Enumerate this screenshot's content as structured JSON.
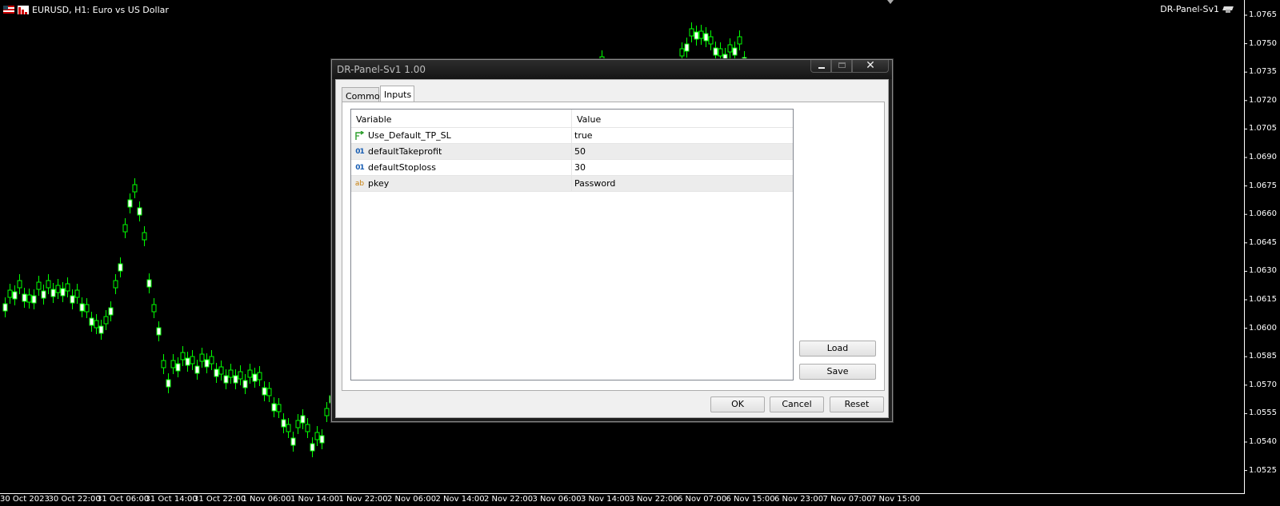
{
  "chart": {
    "symbol_title": "EURUSD, H1:  Euro vs US Dollar",
    "ea_name": "DR-Panel-Sv1",
    "colors": {
      "background": "#000000",
      "candle": "#00ff00",
      "text": "#ffffff"
    },
    "price_labels": [
      "1.0765",
      "1.0750",
      "1.0735",
      "1.0720",
      "1.0705",
      "1.0690",
      "1.0675",
      "1.0660",
      "1.0645",
      "1.0630",
      "1.0615",
      "1.0600",
      "1.0585",
      "1.0570",
      "1.0555",
      "1.0540",
      "1.0525"
    ],
    "time_labels": [
      "30 Oct 2023",
      "30 Oct 22:00",
      "31 Oct 06:00",
      "31 Oct 14:00",
      "31 Oct 22:00",
      "1 Nov 06:00",
      "1 Nov 14:00",
      "1 Nov 22:00",
      "2 Nov 06:00",
      "2 Nov 14:00",
      "2 Nov 22:00",
      "3 Nov 06:00",
      "3 Nov 14:00",
      "3 Nov 22:00",
      "6 Nov 07:00",
      "6 Nov 15:00",
      "6 Nov 23:00",
      "7 Nov 07:00",
      "7 Nov 15:00"
    ]
  },
  "dialog": {
    "title": "DR-Panel-Sv1 1.00",
    "tabs": [
      "Common",
      "Inputs"
    ],
    "active_tab": "Inputs",
    "columns": [
      "Variable",
      "Value"
    ],
    "rows": [
      {
        "icon": "bool-arrow-icon",
        "variable": "Use_Default_TP_SL",
        "value": "true"
      },
      {
        "icon": "numeric-icon",
        "icon_text": "01",
        "variable": "defaultTakeprofit",
        "value": "50"
      },
      {
        "icon": "numeric-icon",
        "icon_text": "01",
        "variable": "defaultStoploss",
        "value": "30"
      },
      {
        "icon": "string-icon",
        "icon_text": "ab",
        "variable": "pkey",
        "value": "Password"
      }
    ],
    "buttons": {
      "load": "Load",
      "save": "Save",
      "ok": "OK",
      "cancel": "Cancel",
      "reset": "Reset"
    }
  }
}
